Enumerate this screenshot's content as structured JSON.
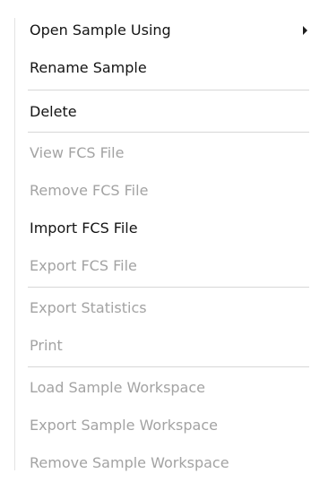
{
  "menu": {
    "items": [
      {
        "label": "Open Sample Using",
        "enabled": true,
        "has_submenu": true
      },
      {
        "label": "Rename Sample",
        "enabled": true
      },
      {
        "label": "Delete",
        "enabled": true
      },
      {
        "label": "View FCS File",
        "enabled": false
      },
      {
        "label": "Remove FCS File",
        "enabled": false
      },
      {
        "label": "Import FCS File",
        "enabled": true
      },
      {
        "label": "Export FCS File",
        "enabled": false
      },
      {
        "label": "Export Statistics",
        "enabled": false
      },
      {
        "label": "Print",
        "enabled": false
      },
      {
        "label": "Load Sample Workspace",
        "enabled": false
      },
      {
        "label": "Export Sample Workspace",
        "enabled": false
      },
      {
        "label": "Remove Sample Workspace",
        "enabled": false
      }
    ]
  },
  "colors": {
    "enabled_text": "#141414",
    "disabled_text": "#a3a3a3",
    "separator": "#d7d7d7",
    "background": "#ffffff"
  }
}
